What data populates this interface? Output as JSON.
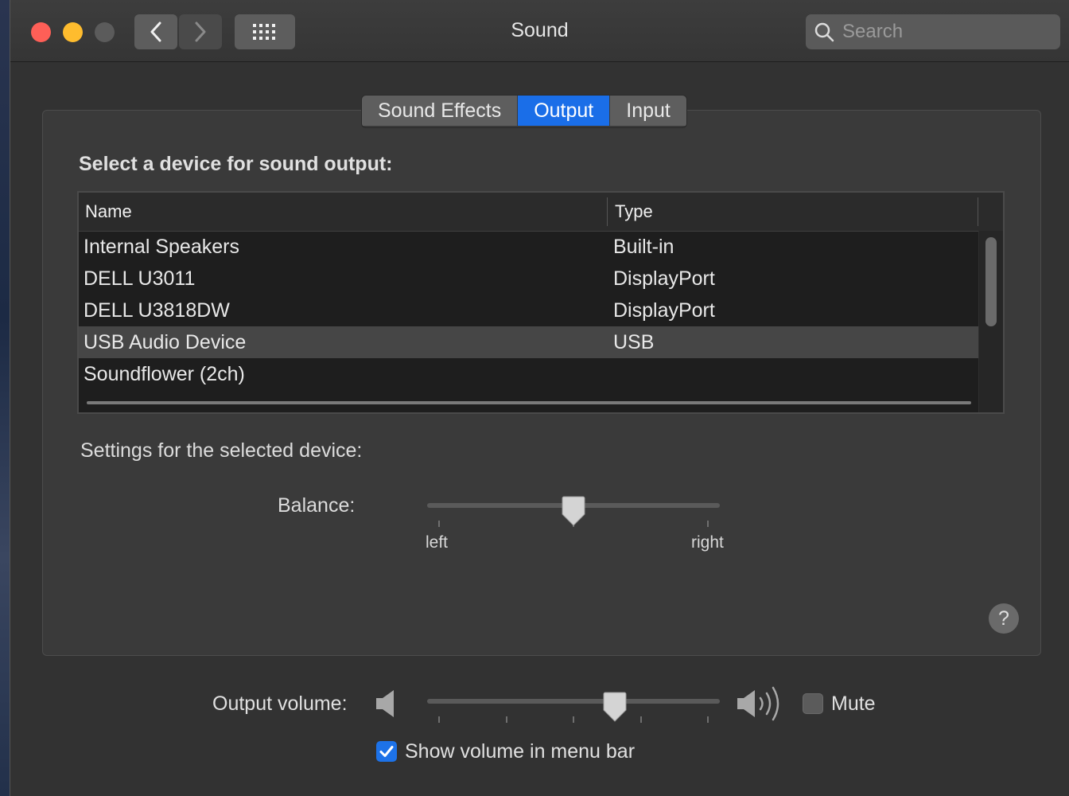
{
  "window": {
    "title": "Sound"
  },
  "toolbar": {
    "back_icon": "chevron-left-icon",
    "forward_icon": "chevron-right-icon",
    "grid_icon": "grid-icon",
    "search_placeholder": "Search"
  },
  "tabs": [
    {
      "label": "Sound Effects",
      "active": false
    },
    {
      "label": "Output",
      "active": true
    },
    {
      "label": "Input",
      "active": false
    }
  ],
  "output": {
    "section_label": "Select a device for sound output:",
    "columns": [
      "Name",
      "Type"
    ],
    "devices": [
      {
        "name": "Internal Speakers",
        "type": "Built-in"
      },
      {
        "name": "DELL U3011",
        "type": "DisplayPort"
      },
      {
        "name": "DELL U3818DW",
        "type": "DisplayPort"
      },
      {
        "name": "USB Audio Device",
        "type": "USB",
        "selected": true
      },
      {
        "name": "Soundflower (2ch)",
        "type": ""
      }
    ],
    "settings_label": "Settings for the selected device:",
    "balance": {
      "label": "Balance:",
      "left_label": "left",
      "right_label": "right",
      "value": 0.5
    }
  },
  "footer": {
    "volume_label": "Output volume:",
    "volume_value": 0.64,
    "mute_label": "Mute",
    "mute_checked": false,
    "menu_bar_label": "Show volume in menu bar",
    "menu_bar_checked": true,
    "help_label": "?"
  },
  "colors": {
    "accent": "#1a6ee8",
    "window_bg": "#323232",
    "panel_bg": "#3a3a3a"
  }
}
